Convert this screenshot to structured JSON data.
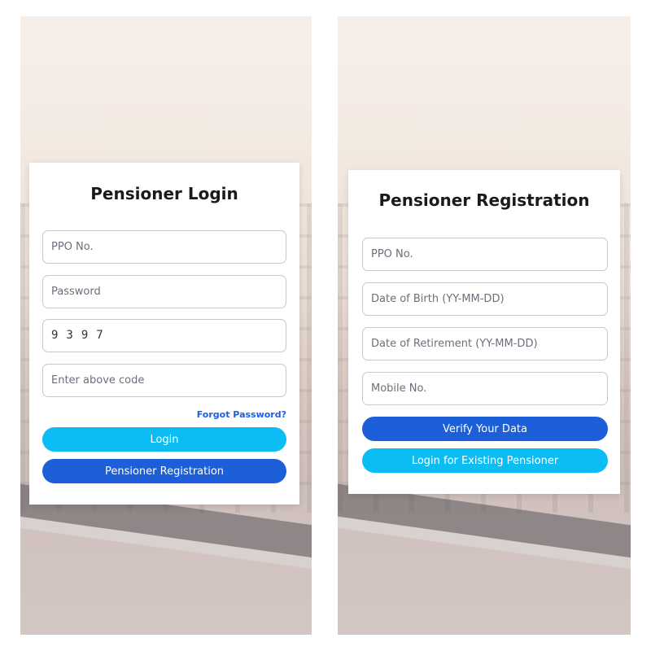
{
  "login": {
    "title": "Pensioner Login",
    "ppo_placeholder": "PPO No.",
    "password_placeholder": "Password",
    "captcha_code": "9397",
    "captcha_input_placeholder": "Enter above code",
    "forgot_password": "Forgot Password?",
    "login_button": "Login",
    "registration_button": "Pensioner Registration"
  },
  "registration": {
    "title": "Pensioner Registration",
    "ppo_placeholder": "PPO No.",
    "dob_placeholder": "Date of Birth (YY-MM-DD)",
    "retirement_placeholder": "Date of Retirement (YY-MM-DD)",
    "mobile_placeholder": "Mobile No.",
    "verify_button": "Verify Your Data",
    "existing_login_button": "Login for Existing Pensioner"
  },
  "colors": {
    "primary_blue": "#1c5fd8",
    "cyan": "#0cbdf4",
    "link_blue": "#1a5fe0"
  }
}
